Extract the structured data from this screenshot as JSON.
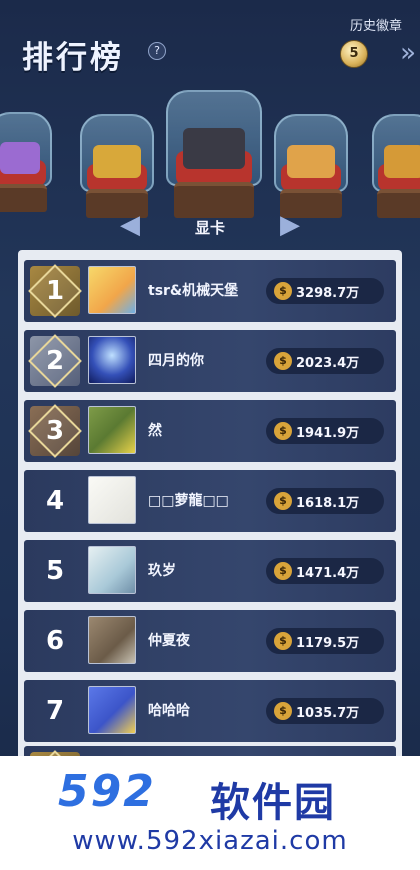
{
  "header": {
    "title": "排行榜",
    "help_glyph": "?",
    "history_label": "历史徽章",
    "badge_value": "5"
  },
  "carousel": {
    "selected_label": "显卡",
    "items": [
      {
        "icon": "purple-gem-icon",
        "color": "#9b6bd1"
      },
      {
        "icon": "bitcoin-icon",
        "color": "#d8a83a"
      },
      {
        "icon": "graphics-card-icon",
        "color": "#3a3a45"
      },
      {
        "icon": "glowing-gem-icon",
        "color": "#e0a34a"
      },
      {
        "icon": "gold-ornament-icon",
        "color": "#d59a37"
      }
    ]
  },
  "rankings": [
    {
      "rank": "1",
      "name": "tsr&机械天堡",
      "score": "3298.7万",
      "medal": "gold",
      "avatar_color": "#f0c84a"
    },
    {
      "rank": "2",
      "name": "四月的你",
      "score": "2023.4万",
      "medal": "silver",
      "avatar_color": "#2b3f9a"
    },
    {
      "rank": "3",
      "name": "然",
      "score": "1941.9万",
      "medal": "bronze",
      "avatar_color": "#6f8a3c"
    },
    {
      "rank": "4",
      "name": "□□萝龍□□",
      "score": "1618.1万",
      "medal": "none",
      "avatar_color": "#f2f2ee"
    },
    {
      "rank": "5",
      "name": "玖岁",
      "score": "1471.4万",
      "medal": "none",
      "avatar_color": "#cfe2ea"
    },
    {
      "rank": "6",
      "name": "仲夏夜",
      "score": "1179.5万",
      "medal": "none",
      "avatar_color": "#8c7a66"
    },
    {
      "rank": "7",
      "name": "哈哈哈",
      "score": "1035.7万",
      "medal": "none",
      "avatar_color": "#4f6ad8"
    }
  ],
  "coin_glyph": "$",
  "watermark": {
    "logo": "592",
    "text": "软件园",
    "url": "www.592xiazai.com"
  }
}
